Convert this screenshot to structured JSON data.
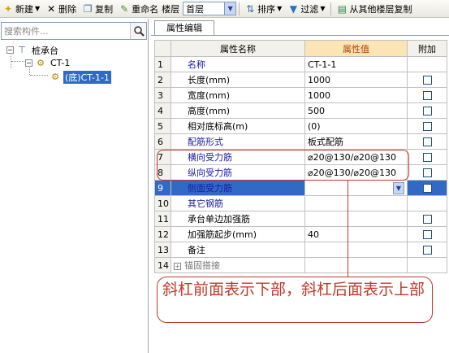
{
  "toolbar": {
    "new_label": "新建",
    "delete_label": "删除",
    "copy_label": "复制",
    "rename_label": "重命名",
    "floor_label": "楼层",
    "floor_value": "首层",
    "sort_label": "排序",
    "filter_label": "过滤",
    "copy_from_label": "从其他楼层复制"
  },
  "sidebar": {
    "search_placeholder": "搜索构件...",
    "tree": [
      {
        "label": "桩承台",
        "icon": "pile-cap-icon",
        "expander": "−"
      },
      {
        "label": "CT-1",
        "icon": "gear-icon",
        "expander": "−"
      },
      {
        "label": "(底)CT-1-1",
        "icon": "gear-icon",
        "selected": true
      }
    ]
  },
  "panel": {
    "tab_label": "属性编辑",
    "headers": [
      "属性名称",
      "属性值",
      "附加"
    ],
    "rows": [
      {
        "num": "1",
        "name": "名称",
        "value": "CT-1-1",
        "style": "blue",
        "checkbox": false
      },
      {
        "num": "2",
        "name": "长度(mm)",
        "value": "1000",
        "style": "black",
        "checkbox": true
      },
      {
        "num": "3",
        "name": "宽度(mm)",
        "value": "1000",
        "style": "black",
        "checkbox": true
      },
      {
        "num": "4",
        "name": "高度(mm)",
        "value": "500",
        "style": "black",
        "checkbox": true
      },
      {
        "num": "5",
        "name": "相对底标高(m)",
        "value": "(0)",
        "style": "black",
        "checkbox": true
      },
      {
        "num": "6",
        "name": "配筋形式",
        "value": "板式配筋",
        "style": "blue",
        "checkbox": true
      },
      {
        "num": "7",
        "name": "横向受力筋",
        "value": "⌀20@130/⌀20@130",
        "style": "blue",
        "checkbox": true
      },
      {
        "num": "8",
        "name": "纵向受力筋",
        "value": "⌀20@130/⌀20@130",
        "style": "blue",
        "checkbox": true
      },
      {
        "num": "9",
        "name": "侧面受力筋",
        "value": "",
        "style": "blue",
        "checkbox": true,
        "selected": true
      },
      {
        "num": "10",
        "name": "其它钢筋",
        "value": "",
        "style": "blue",
        "checkbox": false
      },
      {
        "num": "11",
        "name": "承台单边加强筋",
        "value": "",
        "style": "black",
        "checkbox": true
      },
      {
        "num": "12",
        "name": "加强筋起步(mm)",
        "value": "40",
        "style": "black",
        "checkbox": true
      },
      {
        "num": "13",
        "name": "备注",
        "value": "",
        "style": "black",
        "checkbox": true
      },
      {
        "num": "14",
        "name": "锚固搭接",
        "value": "",
        "style": "gray",
        "checkbox": false,
        "expandable": true
      }
    ]
  },
  "annotation": {
    "callout_text": "斜杠前面表示下部，斜杠后面表示上部",
    "color": "#c0392b"
  }
}
